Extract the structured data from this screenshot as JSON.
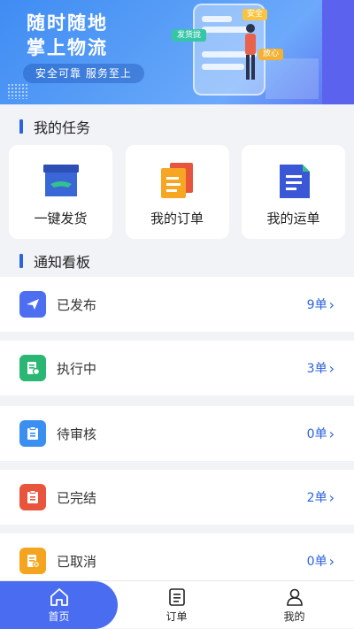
{
  "banner": {
    "line1": "随时随地",
    "line2": "掌上物流",
    "slogan": "安全可靠  服务至上",
    "tag_send": "发货拢",
    "tag_safe": "安全",
    "tag_heart": "放心"
  },
  "tasks": {
    "title": "我的任务",
    "items": [
      {
        "label": "一键发货",
        "icon": "box-icon"
      },
      {
        "label": "我的订单",
        "icon": "order-doc-icon"
      },
      {
        "label": "我的运单",
        "icon": "waybill-doc-icon"
      }
    ]
  },
  "notices": {
    "title": "通知看板",
    "items": [
      {
        "label": "已发布",
        "count": "9单",
        "color": "#4d6ef0",
        "icon": "paper-plane-icon"
      },
      {
        "label": "执行中",
        "count": "3单",
        "color": "#2bb673",
        "icon": "doc-gear-icon"
      },
      {
        "label": "待审核",
        "count": "0单",
        "color": "#3b8ff0",
        "icon": "clipboard-icon"
      },
      {
        "label": "已完结",
        "count": "2单",
        "color": "#e9553c",
        "icon": "clipboard-check-icon"
      },
      {
        "label": "已取消",
        "count": "0单",
        "color": "#f4a41e",
        "icon": "doc-cancel-icon"
      }
    ]
  },
  "tabbar": {
    "home": "首页",
    "orders": "订单",
    "mine": "我的"
  },
  "colors": {
    "accent": "#2d63e0",
    "tab_active": "#4a6cf0"
  }
}
